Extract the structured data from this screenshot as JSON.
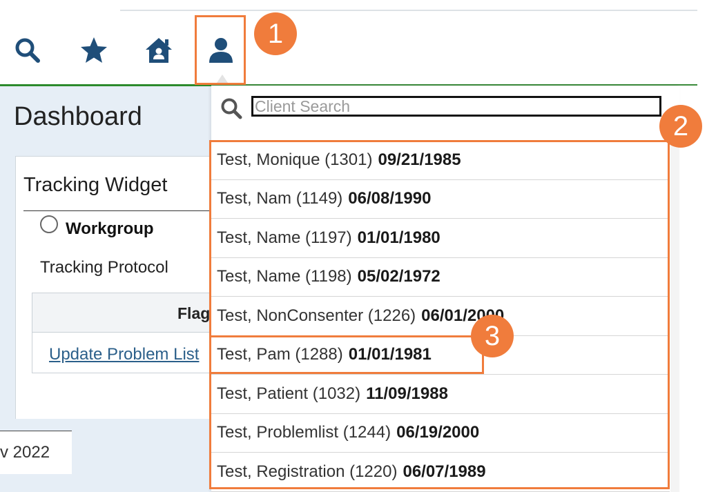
{
  "nav": {
    "icons": [
      "search-icon",
      "star-icon",
      "home-icon",
      "user-icon"
    ],
    "accent_color": "#2c8a2c",
    "icon_color": "#1f4e79"
  },
  "callouts": {
    "one": "1",
    "two": "2",
    "three": "3",
    "color": "#f07c3c"
  },
  "dashboard": {
    "title": "Dashboard",
    "widget": {
      "title": "Tracking Widget",
      "radio_label": "Workgroup",
      "protocol_label": "Tracking Protocol",
      "grid_header": "Flag",
      "grid_link": "Update Problem List"
    },
    "footer_text": "v 2022"
  },
  "client_search": {
    "placeholder": "Client Search",
    "results": [
      {
        "name": "Test, Monique (1301)",
        "dob": "09/21/1985"
      },
      {
        "name": "Test, Nam (1149)",
        "dob": "06/08/1990"
      },
      {
        "name": "Test, Name (1197)",
        "dob": "01/01/1980"
      },
      {
        "name": "Test, Name (1198)",
        "dob": "05/02/1972"
      },
      {
        "name": "Test, NonConsenter (1226)",
        "dob": "06/01/2000"
      },
      {
        "name": "Test, Pam (1288)",
        "dob": "01/01/1981"
      },
      {
        "name": "Test, Patient (1032)",
        "dob": "11/09/1988"
      },
      {
        "name": "Test, Problemlist (1244)",
        "dob": "06/19/2000"
      },
      {
        "name": "Test, Registration (1220)",
        "dob": "06/07/1989"
      }
    ]
  }
}
